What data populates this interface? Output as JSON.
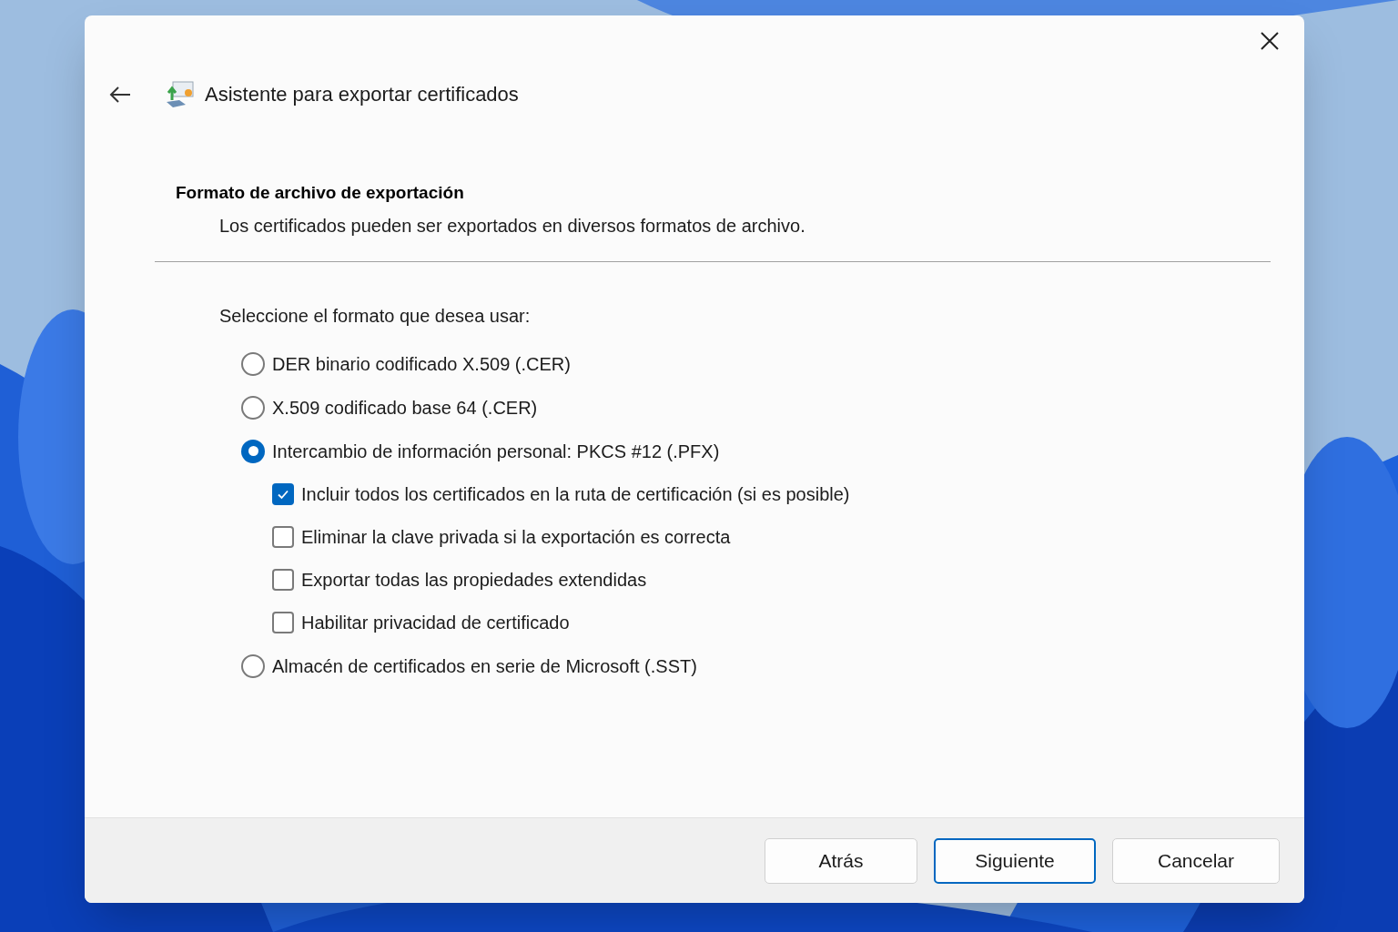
{
  "window": {
    "title": "Asistente para exportar certificados"
  },
  "header": {
    "title": "Formato de archivo de exportación",
    "subtitle": "Los certificados pueden ser exportados en diversos formatos de archivo."
  },
  "prompt": "Seleccione el formato que desea usar:",
  "options": [
    {
      "label": "DER binario codificado X.509 (.CER)",
      "selected": false
    },
    {
      "label": "X.509 codificado base 64 (.CER)",
      "selected": false
    },
    {
      "label": "Intercambio de información personal: PKCS #12 (.PFX)",
      "selected": true,
      "children": [
        {
          "label": "Incluir todos los certificados en la ruta de certificación (si es posible)",
          "checked": true
        },
        {
          "label": "Eliminar la clave privada si la exportación es correcta",
          "checked": false
        },
        {
          "label": "Exportar todas las propiedades extendidas",
          "checked": false
        },
        {
          "label": "Habilitar privacidad de certificado",
          "checked": false
        }
      ]
    },
    {
      "label": "Almacén de certificados en serie de Microsoft (.SST)",
      "selected": false
    }
  ],
  "buttons": [
    {
      "label": "Atrás",
      "focused": false
    },
    {
      "label": "Siguiente",
      "focused": true
    },
    {
      "label": "Cancelar",
      "focused": false
    }
  ]
}
